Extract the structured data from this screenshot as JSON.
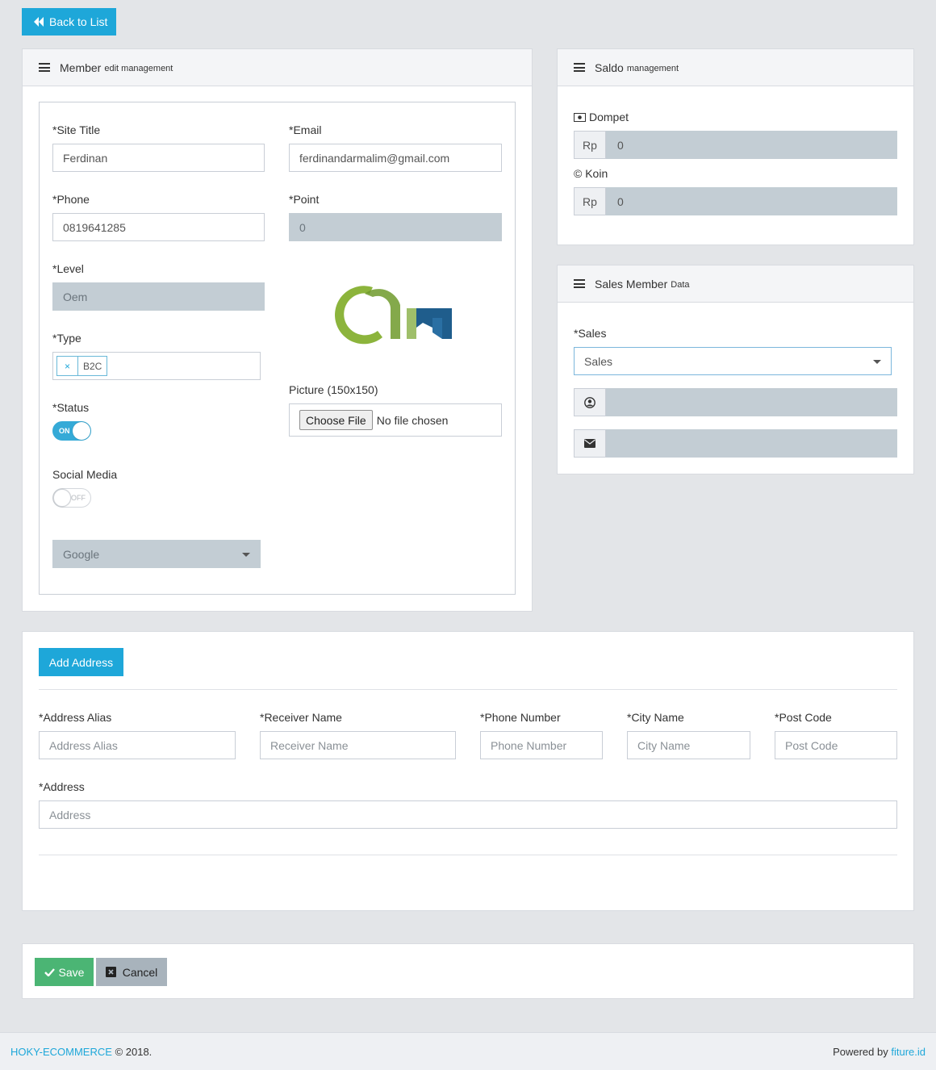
{
  "back_button": {
    "label": "Back to List"
  },
  "member_panel": {
    "title": "Member",
    "subtitle": "edit management",
    "site_title": {
      "label": "*Site Title",
      "value": "Ferdinan"
    },
    "email": {
      "label": "*Email",
      "value": "ferdinandarmalim@gmail.com"
    },
    "phone": {
      "label": "*Phone",
      "value": "0819641285"
    },
    "point": {
      "label": "*Point",
      "value": "0"
    },
    "level": {
      "label": "*Level",
      "value": "Oem"
    },
    "type": {
      "label": "*Type",
      "tag": "B2C",
      "remove": "×"
    },
    "status": {
      "label": "*Status",
      "toggle": "ON"
    },
    "social_media": {
      "label": "Social Media",
      "toggle": "OFF",
      "select_value": "Google"
    },
    "picture": {
      "label": "Picture (150x150)",
      "choose_label": "Choose File",
      "file_status": "No file chosen"
    }
  },
  "saldo_panel": {
    "title": "Saldo",
    "subtitle": "management",
    "dompet": {
      "label": "Dompet",
      "addon": "Rp",
      "value": "0"
    },
    "koin": {
      "label": "© Koin",
      "addon": "Rp",
      "value": "0"
    }
  },
  "sales_panel": {
    "title": "Sales Member",
    "subtitle": "Data",
    "sales": {
      "label": "*Sales",
      "value": "Sales"
    },
    "name_value": "",
    "email_value": ""
  },
  "address_panel": {
    "add_button": "Add Address",
    "alias": {
      "label": "*Address Alias",
      "placeholder": "Address Alias"
    },
    "receiver": {
      "label": "*Receiver Name",
      "placeholder": "Receiver Name"
    },
    "phone": {
      "label": "*Phone Number",
      "placeholder": "Phone Number"
    },
    "city": {
      "label": "*City Name",
      "placeholder": "City Name"
    },
    "post": {
      "label": "*Post Code",
      "placeholder": "Post Code"
    },
    "address": {
      "label": "*Address",
      "placeholder": "Address"
    }
  },
  "actions": {
    "save": "Save",
    "cancel": "Cancel"
  },
  "footer": {
    "brand": "HOKY-ECOMMERCE",
    "copy": "© 2018.",
    "powered": "Powered by",
    "vendor": "fiture.id"
  },
  "colors": {
    "accent": "#1ea7d9",
    "success": "#4bb574",
    "disabled": "#c3cdd4",
    "logo_green": "#8cb43c",
    "logo_blue": "#1f5d8c"
  }
}
